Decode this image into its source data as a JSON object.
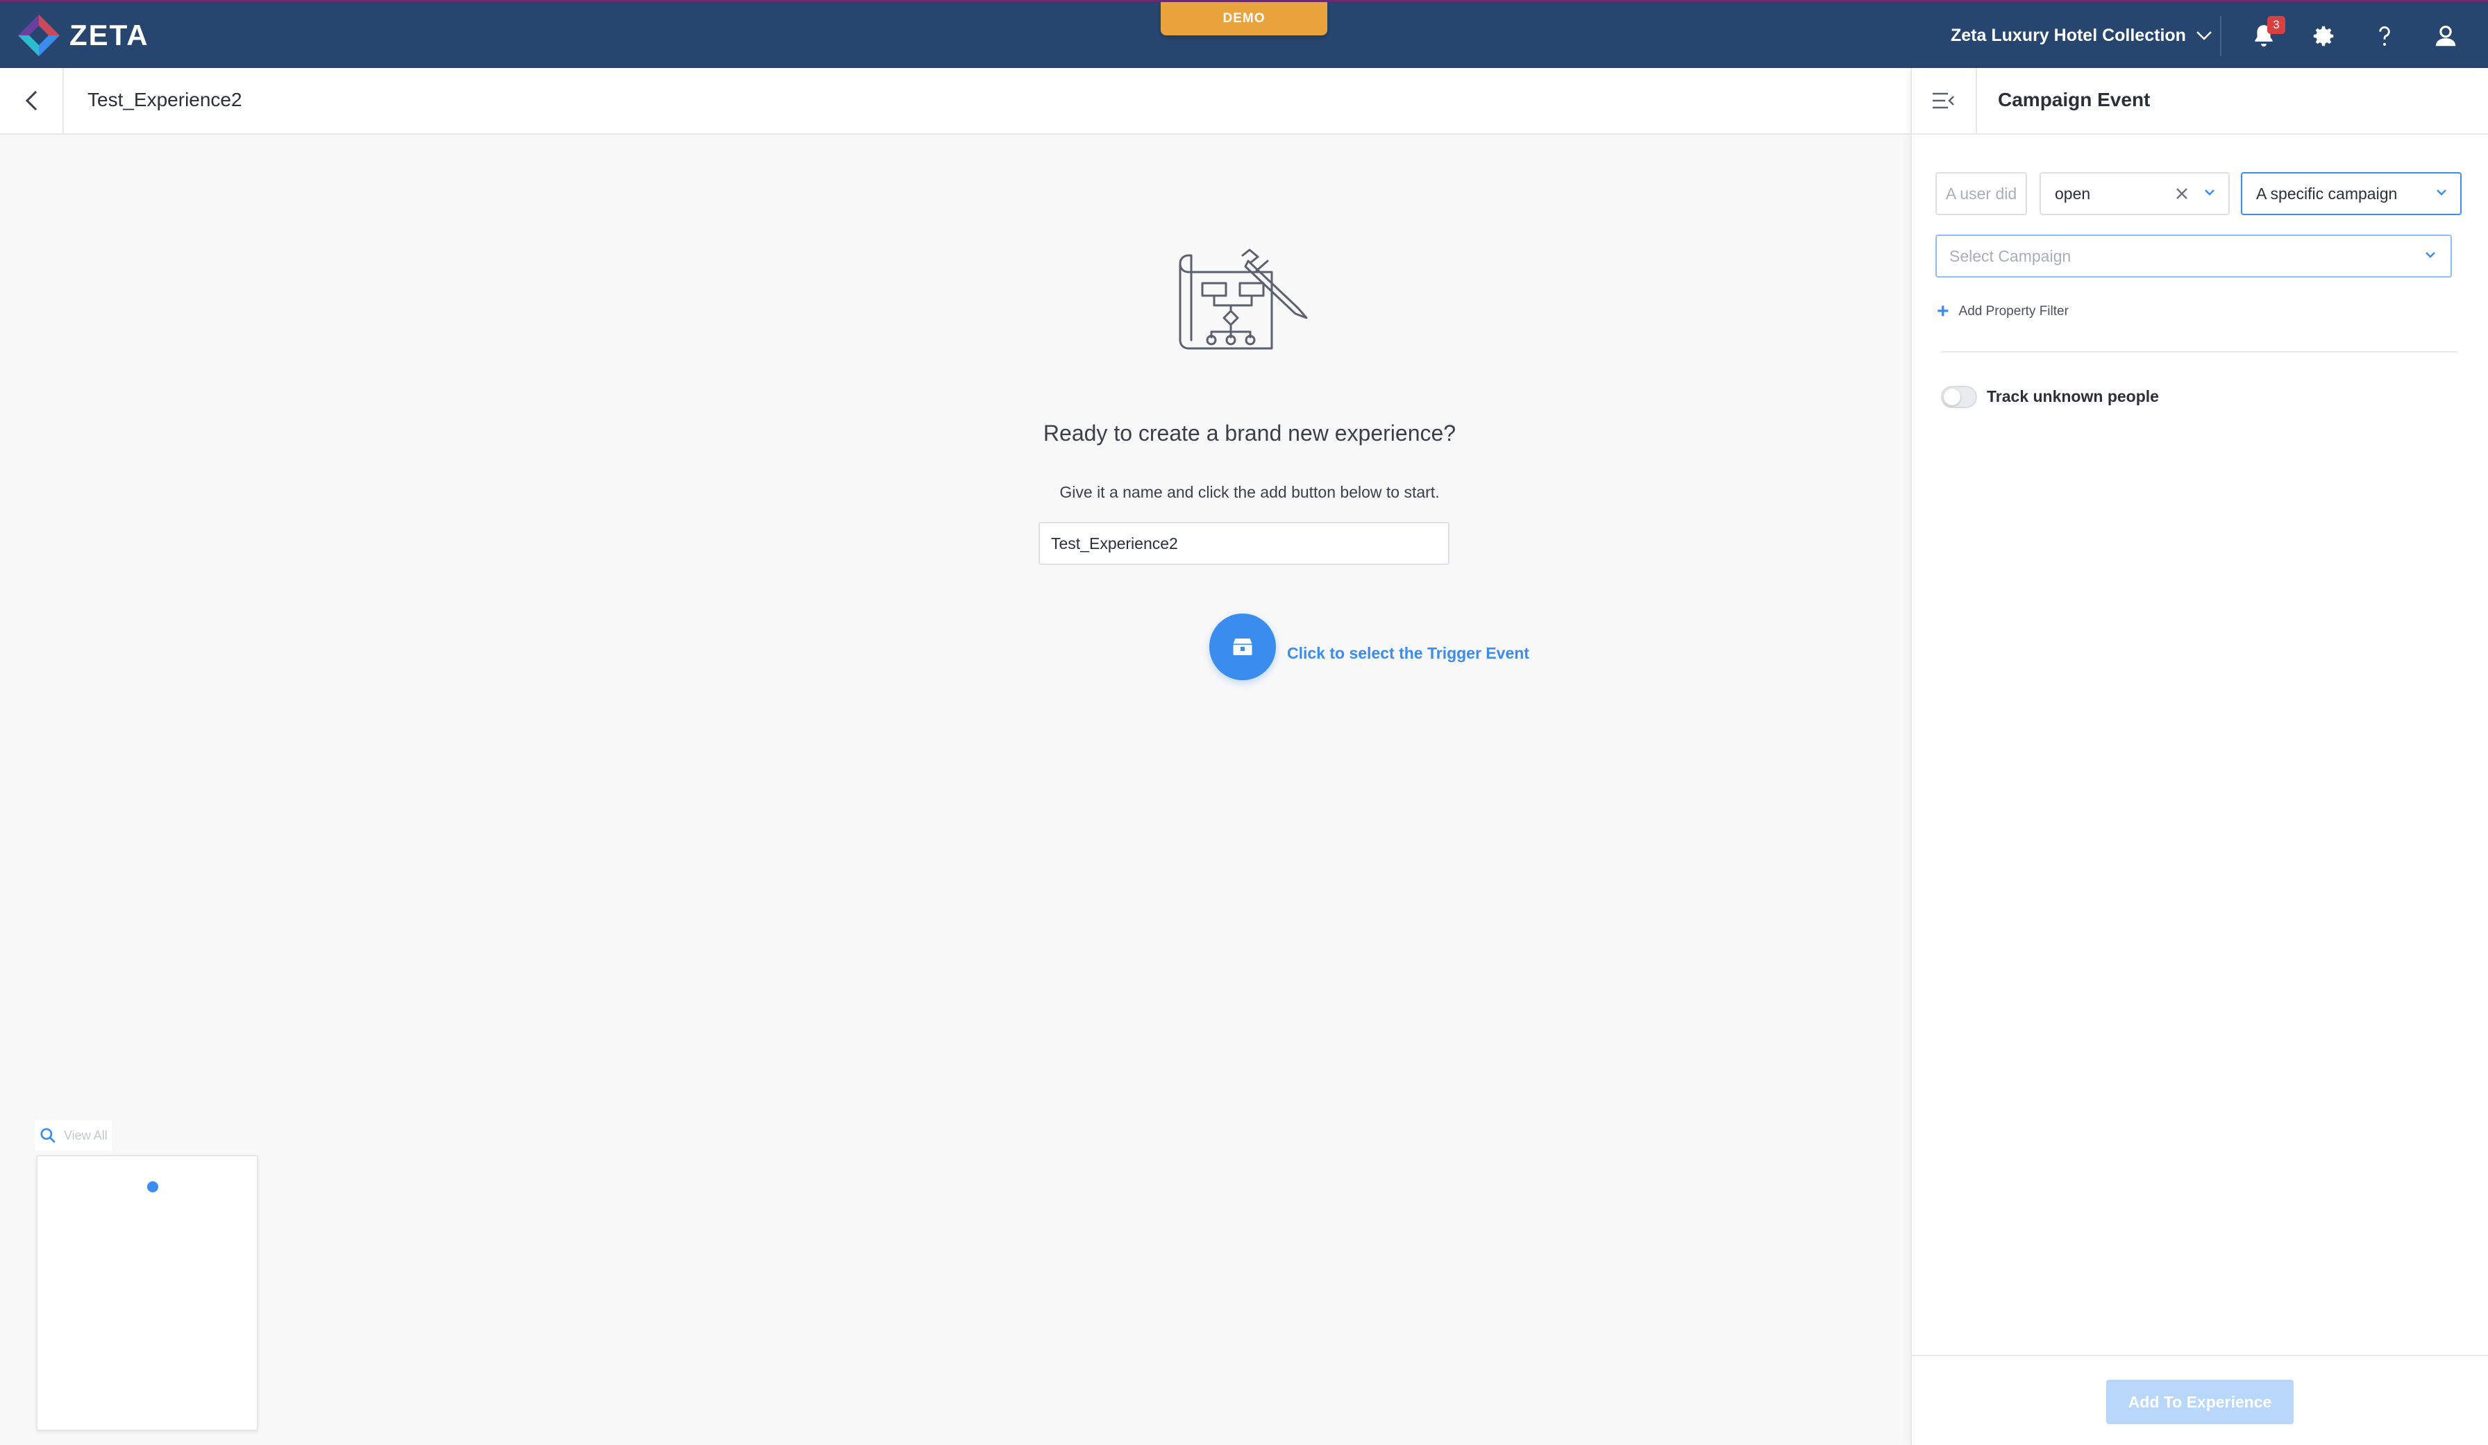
{
  "brand": {
    "name": "ZETA",
    "logo_colors": [
      "#6b3fa0",
      "#c94a5c",
      "#3a8cee",
      "#2dbbd0"
    ]
  },
  "demo_badge": "DEMO",
  "topnav": {
    "org_name": "Zeta Luxury Hotel Collection",
    "notification_count": "3",
    "icons": [
      "bell-icon",
      "gear-icon",
      "help-icon",
      "user-icon"
    ]
  },
  "subheader": {
    "title": "Test_Experience2"
  },
  "empty_state": {
    "title": "Ready to create a brand new experience?",
    "subtitle": "Give it a name and click the add button below to start.",
    "name_value": "Test_Experience2",
    "trigger_label": "Click to select the Trigger Event"
  },
  "minimap": {
    "view_all": "View All"
  },
  "panel": {
    "title": "Campaign Event",
    "static_label": "A user did",
    "event_value": "open",
    "campaign_type_value": "A specific campaign",
    "select_campaign_placeholder": "Select Campaign",
    "add_filter_label": "Add Property Filter",
    "track_unknown_label": "Track unknown people",
    "track_unknown_enabled": false,
    "submit_label": "Add To Experience"
  },
  "colors": {
    "nav_bg": "#27466f",
    "accent": "#3a8cee",
    "demo": "#e8a33d",
    "badge": "#d94040"
  }
}
